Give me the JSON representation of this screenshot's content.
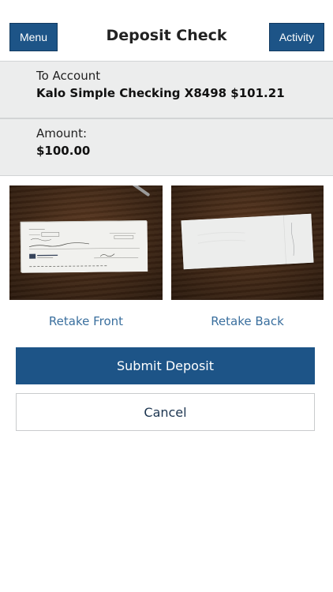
{
  "header": {
    "menu_label": "Menu",
    "title": "Deposit Check",
    "activity_label": "Activity"
  },
  "to_account": {
    "label": "To Account",
    "value": "Kalo Simple Checking X8498 $101.21"
  },
  "amount": {
    "label": "Amount:",
    "value": "$100.00"
  },
  "images": {
    "front_description_icon": "check-front-photo",
    "back_description_icon": "check-back-photo"
  },
  "actions": {
    "retake_front": "Retake Front",
    "retake_back": "Retake Back",
    "submit": "Submit Deposit",
    "cancel": "Cancel"
  },
  "colors": {
    "primary": "#1d5487",
    "link": "#3a6f9e",
    "panel_bg": "#eceded"
  }
}
